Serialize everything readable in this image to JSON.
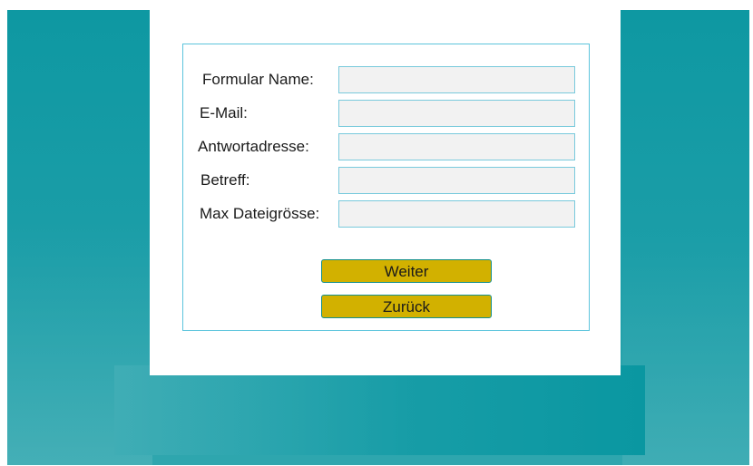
{
  "form": {
    "fields": [
      {
        "label": "Formular Name:",
        "value": "",
        "placeholder": ""
      },
      {
        "label": "E-Mail:",
        "value": "",
        "placeholder": ""
      },
      {
        "label": "Antwortadresse:",
        "value": "",
        "placeholder": ""
      },
      {
        "label": "Betreff:",
        "value": "",
        "placeholder": ""
      },
      {
        "label": "Max Dateigrösse:",
        "value": "",
        "placeholder": ""
      }
    ],
    "buttons": {
      "next_label": "Weiter",
      "back_label": "Zurück"
    }
  },
  "colors": {
    "background_teal": "#0e98a2",
    "frame_border": "#5cc4dc",
    "field_fill": "#f2f2f2",
    "button_fill": "#d2b100",
    "button_border": "#138f8c"
  }
}
